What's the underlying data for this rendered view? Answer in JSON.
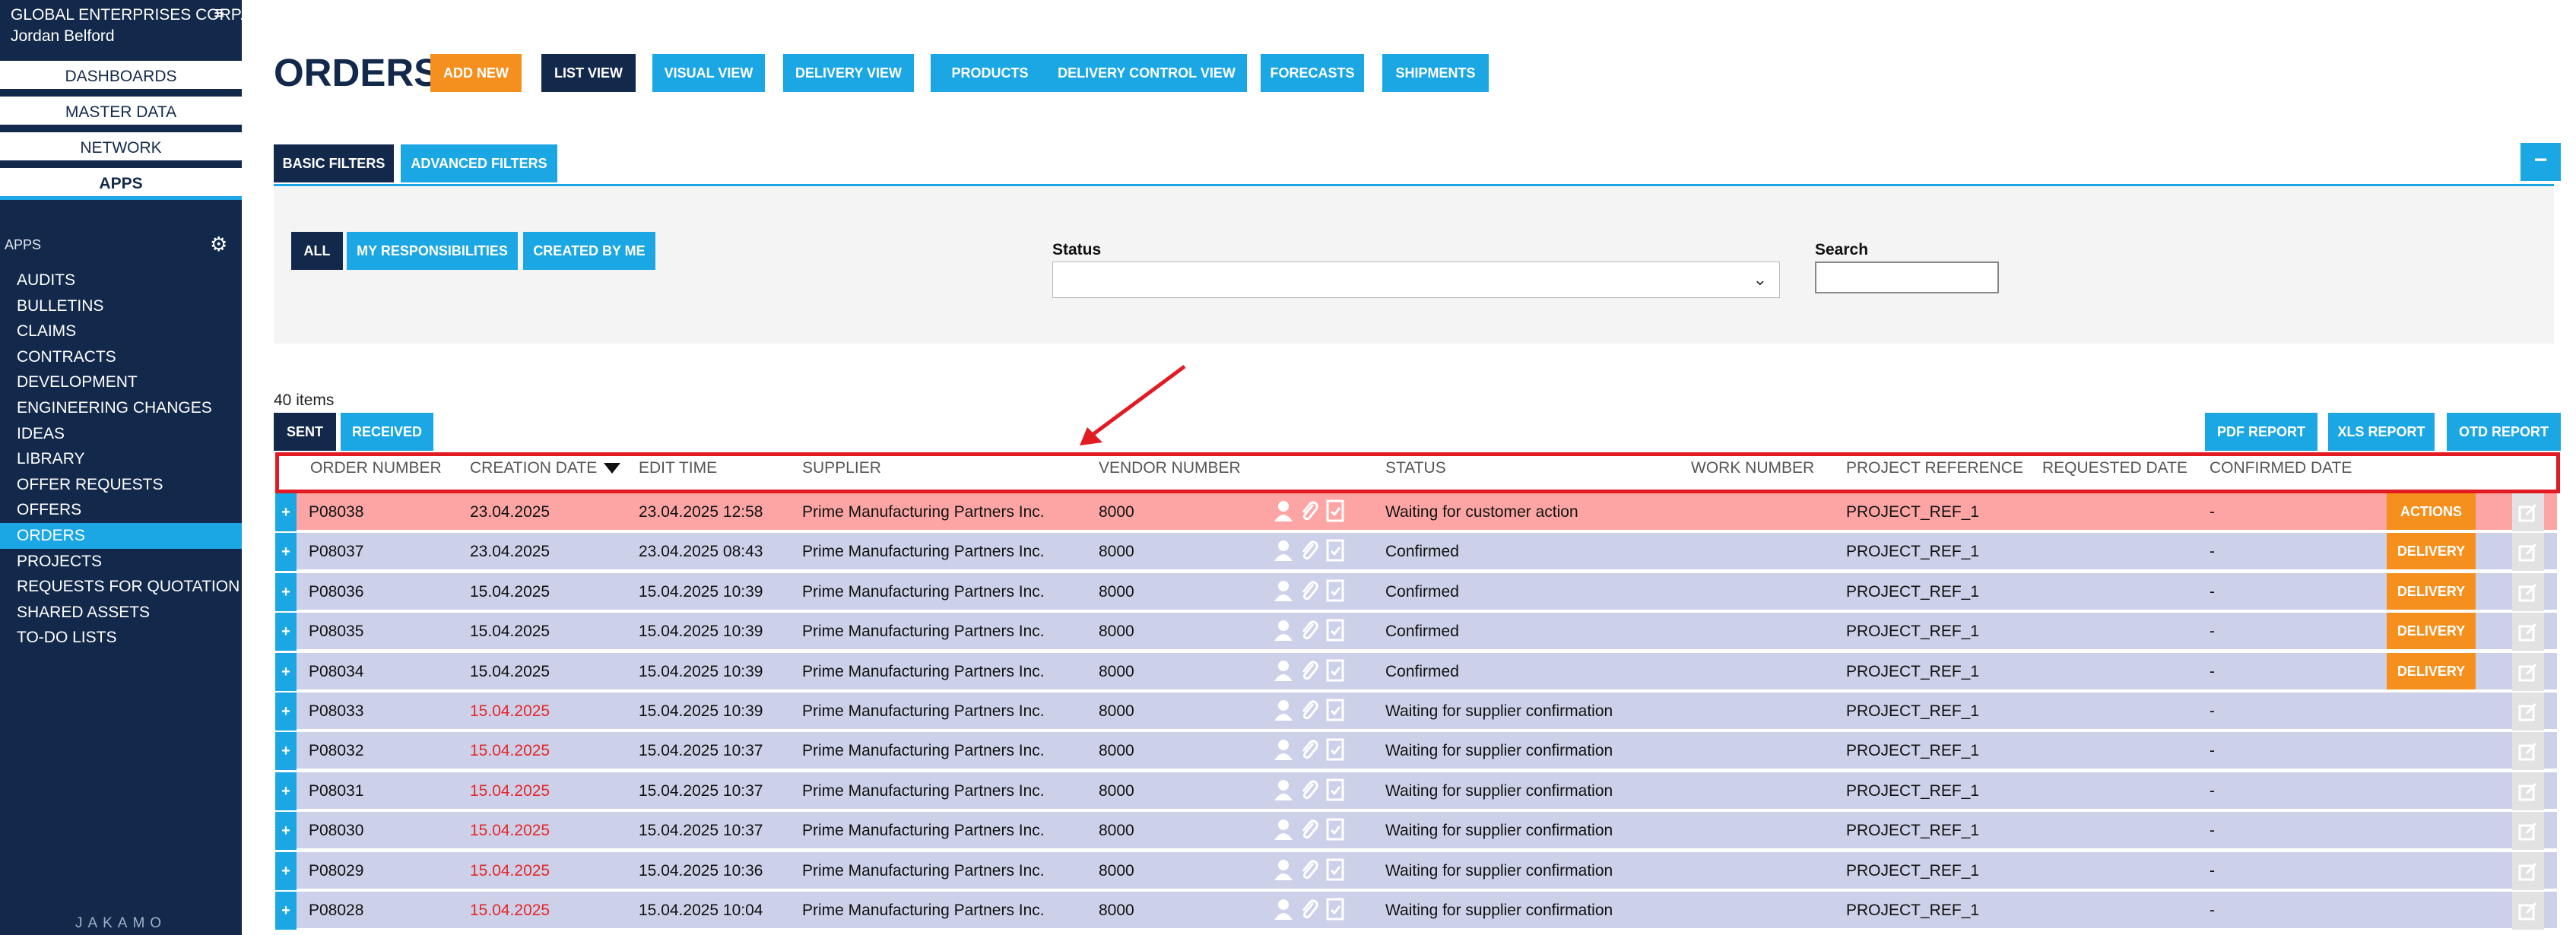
{
  "sidebar": {
    "company": "GLOBAL ENTERPRISES CORP.",
    "user": "Jordan Belford",
    "menu_icon": "hamburger-icon",
    "tabs": [
      "DASHBOARDS",
      "MASTER DATA",
      "NETWORK",
      "APPS"
    ],
    "apps_header": "APPS",
    "settings_icon": "gear-icon",
    "apps": [
      "AUDITS",
      "BULLETINS",
      "CLAIMS",
      "CONTRACTS",
      "DEVELOPMENT",
      "ENGINEERING CHANGES",
      "IDEAS",
      "LIBRARY",
      "OFFER REQUESTS",
      "OFFERS",
      "ORDERS",
      "PROJECTS",
      "REQUESTS FOR QUOTATION",
      "SHARED ASSETS",
      "TO-DO LISTS"
    ],
    "active_app": "ORDERS",
    "brand": "JAKAMO"
  },
  "header": {
    "title": "ORDERS",
    "buttons": [
      "ADD NEW",
      "LIST VIEW",
      "VISUAL VIEW",
      "DELIVERY VIEW",
      "PRODUCTS",
      "DELIVERY CONTROL VIEW",
      "FORECASTS",
      "SHIPMENTS"
    ]
  },
  "filters": {
    "tabs": [
      "BASIC FILTERS",
      "ADVANCED FILTERS"
    ],
    "collapse_label": "−",
    "scope_buttons": [
      "ALL",
      "MY RESPONSIBILITIES",
      "CREATED BY ME"
    ],
    "status_label": "Status",
    "status_value": "",
    "search_label": "Search",
    "search_value": ""
  },
  "list": {
    "count": "40 items",
    "tabs": [
      "SENT",
      "RECEIVED"
    ],
    "reports": [
      "PDF REPORT",
      "XLS REPORT",
      "OTD REPORT"
    ]
  },
  "table": {
    "columns": [
      "ORDER NUMBER",
      "CREATION DATE",
      "EDIT TIME",
      "SUPPLIER",
      "VENDOR NUMBER",
      "STATUS",
      "WORK NUMBER",
      "PROJECT REFERENCE",
      "REQUESTED DATE",
      "CONFIRMED DATE"
    ],
    "row_icons": [
      "user-icon",
      "paperclip-icon",
      "document-icon"
    ],
    "rows": [
      {
        "order": "P08038",
        "created": "23.04.2025",
        "edited": "23.04.2025 12:58",
        "supplier": "Prime Manufacturing Partners Inc.",
        "vendor": "8000",
        "status": "Waiting for customer action",
        "work": "",
        "project": "PROJECT_REF_1",
        "requested": "",
        "confirmed": "-",
        "action": "ACTIONS",
        "created_late": false,
        "highlight": true
      },
      {
        "order": "P08037",
        "created": "23.04.2025",
        "edited": "23.04.2025 08:43",
        "supplier": "Prime Manufacturing Partners Inc.",
        "vendor": "8000",
        "status": "Confirmed",
        "work": "",
        "project": "PROJECT_REF_1",
        "requested": "",
        "confirmed": "-",
        "action": "DELIVERY",
        "created_late": false,
        "highlight": false
      },
      {
        "order": "P08036",
        "created": "15.04.2025",
        "edited": "15.04.2025 10:39",
        "supplier": "Prime Manufacturing Partners Inc.",
        "vendor": "8000",
        "status": "Confirmed",
        "work": "",
        "project": "PROJECT_REF_1",
        "requested": "",
        "confirmed": "-",
        "action": "DELIVERY",
        "created_late": false,
        "highlight": false
      },
      {
        "order": "P08035",
        "created": "15.04.2025",
        "edited": "15.04.2025 10:39",
        "supplier": "Prime Manufacturing Partners Inc.",
        "vendor": "8000",
        "status": "Confirmed",
        "work": "",
        "project": "PROJECT_REF_1",
        "requested": "",
        "confirmed": "-",
        "action": "DELIVERY",
        "created_late": false,
        "highlight": false
      },
      {
        "order": "P08034",
        "created": "15.04.2025",
        "edited": "15.04.2025 10:39",
        "supplier": "Prime Manufacturing Partners Inc.",
        "vendor": "8000",
        "status": "Confirmed",
        "work": "",
        "project": "PROJECT_REF_1",
        "requested": "",
        "confirmed": "-",
        "action": "DELIVERY",
        "created_late": false,
        "highlight": false
      },
      {
        "order": "P08033",
        "created": "15.04.2025",
        "edited": "15.04.2025 10:39",
        "supplier": "Prime Manufacturing Partners Inc.",
        "vendor": "8000",
        "status": "Waiting for supplier confirmation",
        "work": "",
        "project": "PROJECT_REF_1",
        "requested": "",
        "confirmed": "-",
        "action": "",
        "created_late": true,
        "highlight": false
      },
      {
        "order": "P08032",
        "created": "15.04.2025",
        "edited": "15.04.2025 10:37",
        "supplier": "Prime Manufacturing Partners Inc.",
        "vendor": "8000",
        "status": "Waiting for supplier confirmation",
        "work": "",
        "project": "PROJECT_REF_1",
        "requested": "",
        "confirmed": "-",
        "action": "",
        "created_late": true,
        "highlight": false
      },
      {
        "order": "P08031",
        "created": "15.04.2025",
        "edited": "15.04.2025 10:37",
        "supplier": "Prime Manufacturing Partners Inc.",
        "vendor": "8000",
        "status": "Waiting for supplier confirmation",
        "work": "",
        "project": "PROJECT_REF_1",
        "requested": "",
        "confirmed": "-",
        "action": "",
        "created_late": true,
        "highlight": false
      },
      {
        "order": "P08030",
        "created": "15.04.2025",
        "edited": "15.04.2025 10:37",
        "supplier": "Prime Manufacturing Partners Inc.",
        "vendor": "8000",
        "status": "Waiting for supplier confirmation",
        "work": "",
        "project": "PROJECT_REF_1",
        "requested": "",
        "confirmed": "-",
        "action": "",
        "created_late": true,
        "highlight": false
      },
      {
        "order": "P08029",
        "created": "15.04.2025",
        "edited": "15.04.2025 10:36",
        "supplier": "Prime Manufacturing Partners Inc.",
        "vendor": "8000",
        "status": "Waiting for supplier confirmation",
        "work": "",
        "project": "PROJECT_REF_1",
        "requested": "",
        "confirmed": "-",
        "action": "",
        "created_late": true,
        "highlight": false
      },
      {
        "order": "P08028",
        "created": "15.04.2025",
        "edited": "15.04.2025 10:04",
        "supplier": "Prime Manufacturing Partners Inc.",
        "vendor": "8000",
        "status": "Waiting for supplier confirmation",
        "work": "",
        "project": "PROJECT_REF_1",
        "requested": "",
        "confirmed": "-",
        "action": "",
        "created_late": true,
        "highlight": false
      }
    ]
  },
  "colors": {
    "navy": "#13294b",
    "accent_blue": "#1ba7e4",
    "orange": "#f5901e",
    "row_bg": "#ccd0e8",
    "row_highlight": "#fda5a5",
    "late_date": "#e5272b",
    "annotation_red": "#e21b23"
  }
}
